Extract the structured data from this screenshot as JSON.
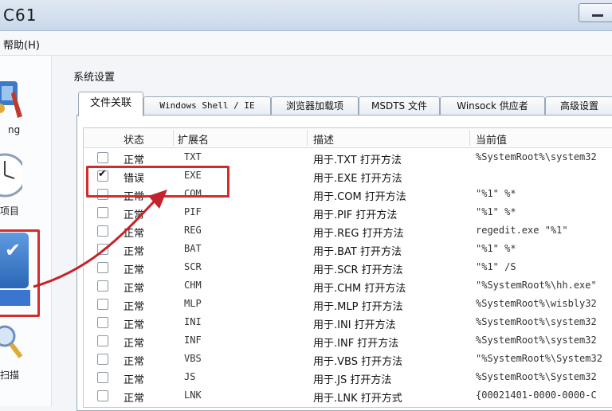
{
  "window": {
    "title": "C61"
  },
  "menu": {
    "help": "帮助(H)"
  },
  "sidebar": {
    "items": [
      {
        "label": "ng",
        "icon": "tools-icon"
      },
      {
        "label": "项目",
        "icon": "clock-icon"
      },
      {
        "label": "",
        "icon": "checklist-icon"
      },
      {
        "label": "扫描",
        "icon": "magnifier-icon"
      }
    ]
  },
  "group": {
    "label": "系统设置"
  },
  "tabs": [
    {
      "label": "文件关联"
    },
    {
      "label": "Windows Shell / IE"
    },
    {
      "label": "浏览器加载项"
    },
    {
      "label": "MSDTS 文件"
    },
    {
      "label": "Winsock 供应者"
    },
    {
      "label": "高级设置"
    }
  ],
  "table": {
    "columns": [
      "状态",
      "扩展名",
      "描述",
      "当前值"
    ],
    "rows": [
      {
        "checked": false,
        "status": "正常",
        "ext": "TXT",
        "desc": "用于.TXT 打开方法",
        "value": "%SystemRoot%\\system32"
      },
      {
        "checked": true,
        "status": "错误",
        "ext": "EXE",
        "desc": "用于.EXE 打开方法",
        "value": ""
      },
      {
        "checked": false,
        "status": "正常",
        "ext": "COM",
        "desc": "用于.COM 打开方法",
        "value": "\"%1\" %*"
      },
      {
        "checked": false,
        "status": "正常",
        "ext": "PIF",
        "desc": "用于.PIF 打开方法",
        "value": "\"%1\" %*"
      },
      {
        "checked": false,
        "status": "正常",
        "ext": "REG",
        "desc": "用于.REG 打开方法",
        "value": "regedit.exe \"%1\""
      },
      {
        "checked": false,
        "status": "正常",
        "ext": "BAT",
        "desc": "用于.BAT 打开方法",
        "value": "\"%1\" %*"
      },
      {
        "checked": false,
        "status": "正常",
        "ext": "SCR",
        "desc": "用于.SCR 打开方法",
        "value": "\"%1\" /S"
      },
      {
        "checked": false,
        "status": "正常",
        "ext": "CHM",
        "desc": "用于.CHM 打开方法",
        "value": "\"%SystemRoot%\\hh.exe\""
      },
      {
        "checked": false,
        "status": "正常",
        "ext": "MLP",
        "desc": "用于.MLP 打开方法",
        "value": "%SystemRoot%\\wisbly32"
      },
      {
        "checked": false,
        "status": "正常",
        "ext": "INI",
        "desc": "用于.INI 打开方法",
        "value": "%SystemRoot%\\system32"
      },
      {
        "checked": false,
        "status": "正常",
        "ext": "INF",
        "desc": "用于.INF 打开方法",
        "value": "%SystemRoot%\\system32"
      },
      {
        "checked": false,
        "status": "正常",
        "ext": "VBS",
        "desc": "用于.VBS 打开方法",
        "value": "\"%SystemRoot%\\System32"
      },
      {
        "checked": false,
        "status": "正常",
        "ext": "JS",
        "desc": "用于.JS 打开方法",
        "value": "%SystemRoot%\\System32"
      },
      {
        "checked": false,
        "status": "正常",
        "ext": "LNK",
        "desc": "用于.LNK 打开方式",
        "value": "{00021401-0000-0000-C"
      }
    ]
  },
  "colors": {
    "annotation": "#d62b2b",
    "selection": "#3a76cf"
  }
}
